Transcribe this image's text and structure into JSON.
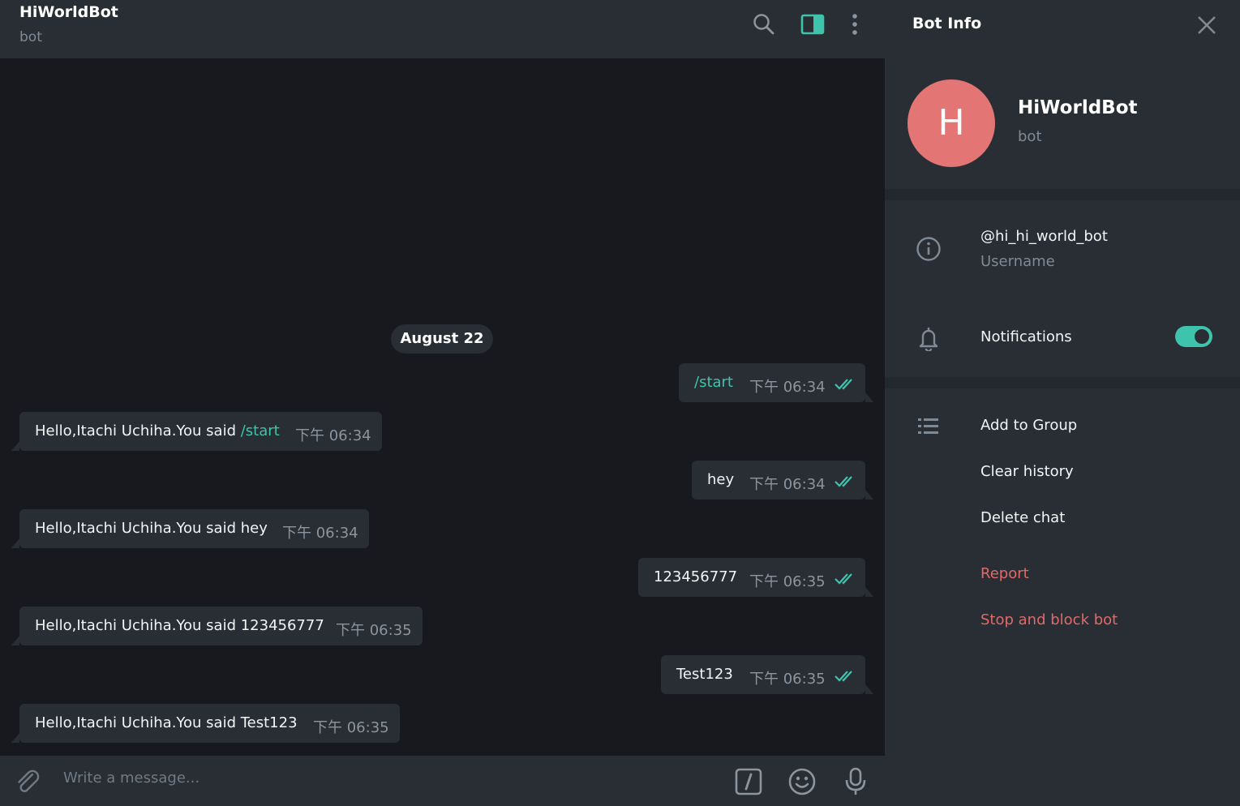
{
  "chat_header": {
    "title": "HiWorldBot",
    "subtitle": "bot",
    "icons": [
      "search-icon",
      "sidebar-toggle-icon",
      "more-vertical-icon"
    ]
  },
  "date_chip": "August 22",
  "messages": [
    {
      "direction": "out",
      "text": "/start",
      "is_command": true,
      "time": "下午 06:34",
      "read": true
    },
    {
      "direction": "in",
      "text": "Hello,Itachi Uchiha.You said ",
      "command": "/start",
      "time": "下午 06:34"
    },
    {
      "direction": "out",
      "text": "hey",
      "time": "下午 06:34",
      "read": true
    },
    {
      "direction": "in",
      "text": "Hello,Itachi Uchiha.You said hey",
      "time": "下午 06:34"
    },
    {
      "direction": "out",
      "text": "123456777",
      "time": "下午 06:35",
      "read": true
    },
    {
      "direction": "in",
      "text": "Hello,Itachi Uchiha.You said 123456777",
      "time": "下午 06:35"
    },
    {
      "direction": "out",
      "text": "Test123",
      "time": "下午 06:35",
      "read": true
    },
    {
      "direction": "in",
      "text": "Hello,Itachi Uchiha.You said Test123",
      "time": "下午 06:35"
    }
  ],
  "composer": {
    "placeholder": "Write a message...",
    "icons": [
      "attach-icon",
      "bot-command-icon",
      "emoji-icon",
      "microphone-icon"
    ]
  },
  "info_panel": {
    "title": "Bot Info",
    "avatar_letter": "H",
    "avatar_color": "#e37575",
    "name": "HiWorldBot",
    "subtitle": "bot",
    "username": "@hi_hi_world_bot",
    "username_label": "Username",
    "notifications_label": "Notifications",
    "notifications_on": true,
    "actions": [
      "Add to Group",
      "Clear history",
      "Delete chat"
    ],
    "danger_actions": [
      "Report",
      "Stop and block bot"
    ]
  },
  "colors": {
    "accent": "#3ec4ad",
    "danger": "#e06a6a",
    "bubble": "#282e33",
    "background": "#17191e"
  }
}
